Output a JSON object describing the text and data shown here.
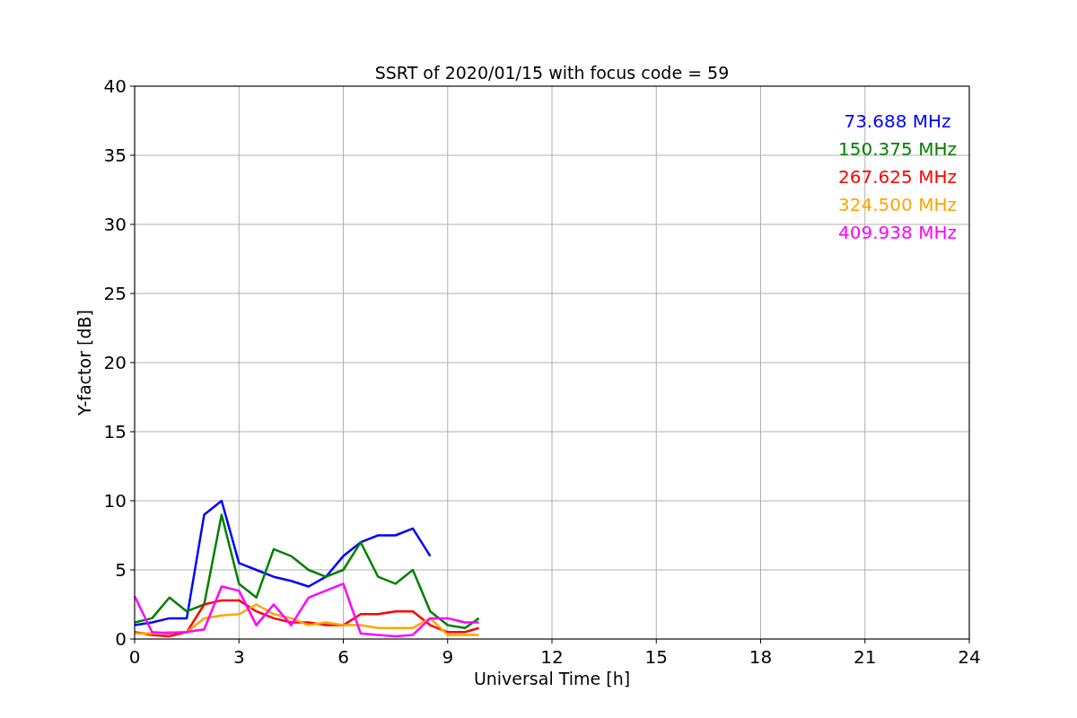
{
  "figure": {
    "chart_data": {
      "type": "line",
      "title": "SSRT of 2020/01/15 with focus code = 59",
      "xlabel": "Universal Time [h]",
      "ylabel": "Y-factor [dB]",
      "x": [
        0,
        0.5,
        1,
        1.5,
        2,
        2.5,
        3,
        3.5,
        4,
        4.5,
        5,
        5.5,
        6,
        6.5,
        7,
        7.5,
        8,
        8.5,
        9,
        9.5,
        9.9
      ],
      "series": [
        {
          "name": "73.688 MHz",
          "color": "#0000ff",
          "values": [
            1,
            1.2,
            1.5,
            1.5,
            9,
            10,
            5.5,
            5,
            4.5,
            4.2,
            3.8,
            4.5,
            6,
            7,
            7.5,
            7.5,
            8,
            6,
            null,
            null,
            null
          ]
        },
        {
          "name": "150.375 MHz",
          "color": "#008000",
          "values": [
            1.2,
            1.5,
            3,
            2,
            2.5,
            9,
            4,
            3,
            6.5,
            6,
            5,
            4.5,
            5,
            7,
            4.5,
            4,
            5,
            2,
            1,
            0.8,
            1.5
          ]
        },
        {
          "name": "267.625 MHz",
          "color": "#ff0000",
          "values": [
            0.5,
            0.3,
            0.2,
            0.5,
            2.5,
            2.8,
            2.8,
            2,
            1.5,
            1.2,
            1.2,
            1,
            1,
            1.8,
            1.8,
            2,
            2,
            1,
            0.5,
            0.5,
            0.8
          ]
        },
        {
          "name": "324.500 MHz",
          "color": "#ffa500",
          "values": [
            0.4,
            0.4,
            0.5,
            0.5,
            1.5,
            1.7,
            1.8,
            2.5,
            1.8,
            1.5,
            1,
            1.2,
            1,
            1,
            0.8,
            0.8,
            0.8,
            1.5,
            0.3,
            0.3,
            0.3
          ]
        },
        {
          "name": "409.938 MHz",
          "color": "#ff00ff",
          "values": [
            3.1,
            0.5,
            0.4,
            0.5,
            0.7,
            3.8,
            3.5,
            1,
            2.5,
            1,
            3,
            3.5,
            4,
            0.4,
            0.3,
            0.2,
            0.3,
            1.5,
            1.5,
            1.2,
            1.2
          ]
        }
      ],
      "grid": true,
      "xlim": [
        0,
        24
      ],
      "ylim": [
        0,
        40
      ],
      "xticks": [
        0,
        3,
        6,
        9,
        12,
        15,
        18,
        21,
        24
      ],
      "yticks": [
        0,
        5,
        10,
        15,
        20,
        25,
        30,
        35,
        40
      ]
    }
  }
}
